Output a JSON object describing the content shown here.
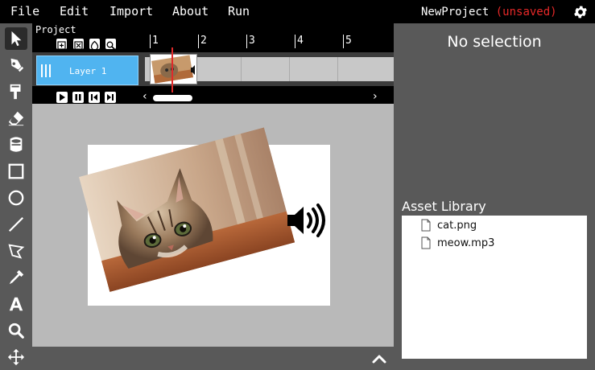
{
  "menu": {
    "file": "File",
    "edit": "Edit",
    "import": "Import",
    "about": "About",
    "run": "Run"
  },
  "project": {
    "name": "NewProject",
    "status": "(unsaved)"
  },
  "toolbar": {
    "tools": [
      {
        "name": "select-tool",
        "icon": "cursor-arrow-icon",
        "active": true
      },
      {
        "name": "pen-tool",
        "icon": "pen-nib-icon"
      },
      {
        "name": "brush-tool",
        "icon": "paintbrush-icon"
      },
      {
        "name": "eraser-tool",
        "icon": "eraser-icon"
      },
      {
        "name": "fill-tool",
        "icon": "paint-bucket-icon"
      },
      {
        "name": "rectangle-tool",
        "icon": "rectangle-icon"
      },
      {
        "name": "ellipse-tool",
        "icon": "circle-icon"
      },
      {
        "name": "line-tool",
        "icon": "line-icon"
      },
      {
        "name": "polygon-tool",
        "icon": "polygon-lasso-icon"
      },
      {
        "name": "eyedropper-tool",
        "icon": "eyedropper-icon"
      },
      {
        "name": "text-tool",
        "icon": "letter-a-icon"
      },
      {
        "name": "zoom-tool",
        "icon": "magnifier-icon"
      },
      {
        "name": "pan-tool",
        "icon": "move-arrows-icon"
      }
    ]
  },
  "timeline": {
    "label": "Project",
    "ruler": [
      "1",
      "2",
      "3",
      "4",
      "5"
    ],
    "layer_name": "Layer 1"
  },
  "inspector": {
    "empty_text": "No selection"
  },
  "assets": {
    "title": "Asset Library",
    "items": [
      "cat.png",
      "meow.mp3"
    ]
  },
  "colors": {
    "accent_layer": "#50b4f0",
    "unsaved": "#e62828",
    "playhead": "#e02a2a"
  }
}
